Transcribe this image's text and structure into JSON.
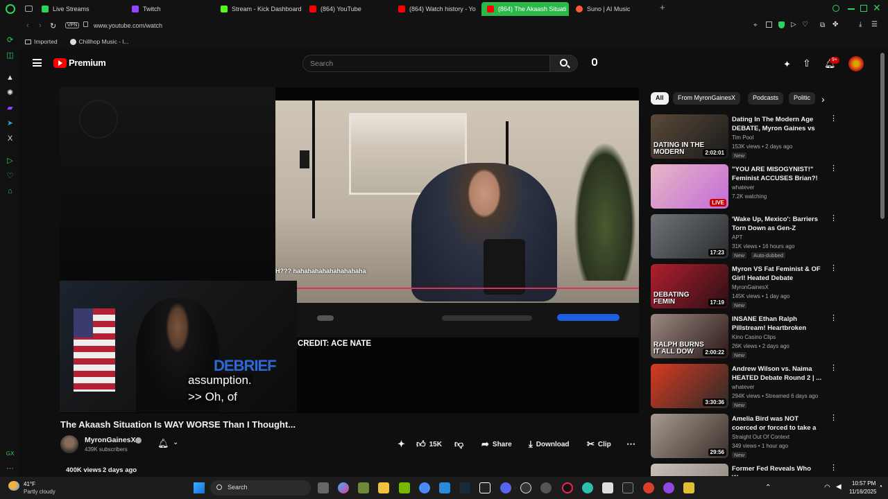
{
  "tabs": [
    {
      "label": "Live Streams",
      "color": "#2bd45c"
    },
    {
      "label": "Twitch",
      "color": "#9146ff"
    },
    {
      "label": "Stream - Kick Dashboard",
      "color": "#53fc18"
    },
    {
      "label": "(864) YouTube",
      "color": "#ff0000"
    },
    {
      "label": "(864) Watch history - Yo",
      "color": "#ff0000"
    },
    {
      "label": "(864) The Akaash Situati",
      "color": "#ff0000"
    },
    {
      "label": "Suno | AI Music",
      "color": "#ff5a36"
    }
  ],
  "address": {
    "vpn": "VPN",
    "url": "www.youtube.com/watch"
  },
  "bookmarks": [
    {
      "label": "Imported"
    },
    {
      "label": "Chillhop Music - l..."
    }
  ],
  "youtube": {
    "logo": "Premium",
    "search_placeholder": "Search",
    "notification_count": "9+"
  },
  "video": {
    "overlay_laugh": "H??? hahahahahahahahahaha",
    "credit": "CREDIT: ACE NATE",
    "caption_line1": "assumption.",
    "caption_line2": ">> Oh, of",
    "title": "The Akaash Situation Is WAY WORSE Than I Thought...",
    "channel": "MyronGainesX",
    "subscribers": "439K subscribers",
    "likes": "15K",
    "share": "Share",
    "download": "Download",
    "clip": "Clip",
    "views": "400K views",
    "age": "2 days ago"
  },
  "filter_chips": [
    {
      "label": "All"
    },
    {
      "label": "From MyronGainesX"
    },
    {
      "label": "Podcasts"
    },
    {
      "label": "Politic"
    }
  ],
  "recommendations": [
    {
      "title": "Dating In The Modern Age DEBATE, Myron Gaines vs Bri...",
      "channel": "Tim Pool",
      "meta": "153K views • 2 days ago",
      "badge": "New",
      "duration": "2:02:01",
      "thumb_text": "DATING IN THE MODERN",
      "colors": [
        "#5a4a3a",
        "#1a1a1a"
      ]
    },
    {
      "title": "\"YOU ARE MISOGYNIST!\" Feminist ACCUSES Brian?! ...",
      "channel": "whatever",
      "meta": "7.2K watching",
      "badge": "",
      "duration": "LIVE",
      "thumb_text": "",
      "colors": [
        "#e6b7c4",
        "#c46bd8"
      ]
    },
    {
      "title": "'Wake Up, Mexico': Barriers Torn Down as Gen-Z Protesters ...",
      "channel": "APT",
      "meta": "31K views • 16 hours ago",
      "badge": "New",
      "badge2": "Auto-dubbed",
      "duration": "17:23",
      "thumb_text": "",
      "colors": [
        "#6f7378",
        "#2a2c2f"
      ]
    },
    {
      "title": "Myron VS Fat Feminist & OF Girl! Heated Debate",
      "channel": "MyronGainesX",
      "meta": "145K views • 1 day ago",
      "badge": "New",
      "duration": "17:19",
      "thumb_text": "DEBATING FEMIN",
      "colors": [
        "#b21f2f",
        "#2a0f14"
      ]
    },
    {
      "title": "INSANE Ethan Ralph Pillstream! Heartbroken Ralph Crashes O...",
      "channel": "Kino Casino Clips",
      "meta": "26K views • 2 days ago",
      "badge": "New",
      "duration": "2:00:22",
      "thumb_text": "RALPH BURNS IT ALL DOW",
      "colors": [
        "#9a8a80",
        "#2a1818"
      ]
    },
    {
      "title": "Andrew Wilson vs. Naima HEATED Debate Round 2 | ...",
      "channel": "whatever",
      "meta": "294K views • Streamed 6 days ago",
      "badge": "New",
      "duration": "3:30:36",
      "thumb_text": "",
      "colors": [
        "#d83a1f",
        "#2a2a2a"
      ]
    },
    {
      "title": "Amelia Bird was NOT coerced or forced to take a plea deal ...",
      "channel": "Straight Out Of Context",
      "meta": "349 views • 1 hour ago",
      "badge": "New",
      "duration": "29:56",
      "thumb_text": "",
      "colors": [
        "#a89a90",
        "#3a2f2a"
      ]
    },
    {
      "title": "Former Fed Reveals Who Was",
      "channel": "",
      "meta": "",
      "badge": "",
      "duration": "",
      "thumb_text": "",
      "colors": [
        "#c8c0b8",
        "#8a8078"
      ]
    }
  ],
  "taskbar": {
    "weather_temp": "41°F",
    "weather_desc": "Partly cloudy",
    "search": "Search",
    "time": "10:57 PM",
    "date": "11/16/2025"
  }
}
